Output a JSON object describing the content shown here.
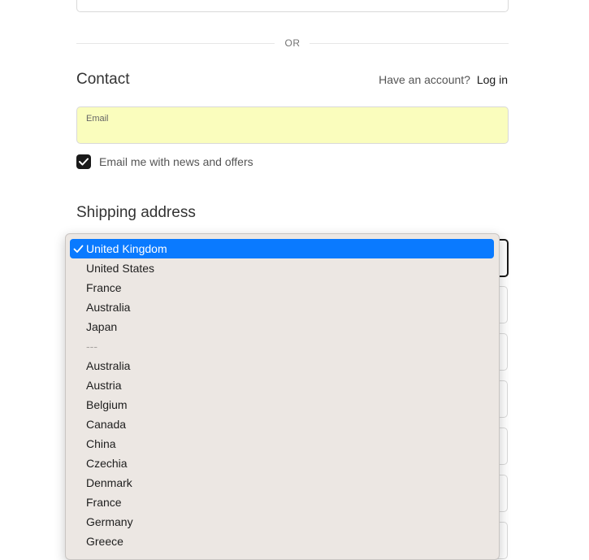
{
  "divider": {
    "or_label": "OR"
  },
  "contact": {
    "heading": "Contact",
    "account_prompt": "Have an account?",
    "login_label": "Log in",
    "email_label": "Email",
    "newsletter_label": "Email me with news and offers",
    "newsletter_checked": true
  },
  "shipping": {
    "heading": "Shipping address",
    "country_options": [
      "United Kingdom",
      "United States",
      "France",
      "Australia",
      "Japan",
      "---",
      "Australia",
      "Austria",
      "Belgium",
      "Canada",
      "China",
      "Czechia",
      "Denmark",
      "France",
      "Germany",
      "Greece"
    ],
    "selected_country": "United Kingdom"
  },
  "colors": {
    "selected_option_bg": "#0a7aff",
    "email_autofill_bg": "#fafdbd",
    "dropdown_bg": "#ece7e3",
    "checkbox_bg": "#1a1a1a"
  },
  "icons": {
    "checkbox": "checkmark-icon",
    "selected_option": "checkmark-icon"
  }
}
